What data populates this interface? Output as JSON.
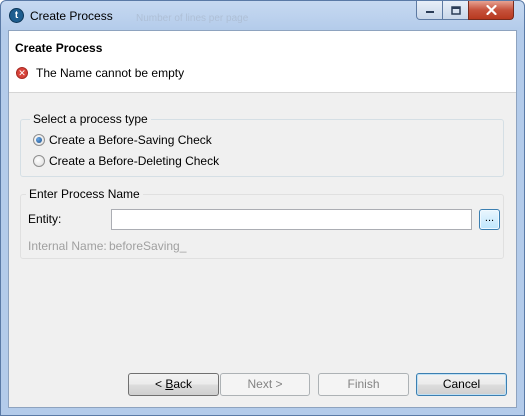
{
  "window": {
    "title": "Create Process",
    "ghost_text": "Number of lines per page"
  },
  "header": {
    "title": "Create Process",
    "error_message": "The Name cannot be empty"
  },
  "process_type": {
    "label": "Select a process type",
    "options": [
      {
        "label": "Create a Before-Saving Check",
        "checked": true
      },
      {
        "label": "Create a Before-Deleting Check",
        "checked": false
      }
    ]
  },
  "process_name": {
    "label": "Enter Process Name",
    "entity_label": "Entity:",
    "entity_value": "",
    "browse_label": "...",
    "internal_name_label": "Internal Name:",
    "internal_name_value": "beforeSaving_"
  },
  "buttons": {
    "back_prefix": "< ",
    "back_mnemonic": "B",
    "back_rest": "ack",
    "next": "Next >",
    "finish": "Finish",
    "cancel": "Cancel"
  }
}
